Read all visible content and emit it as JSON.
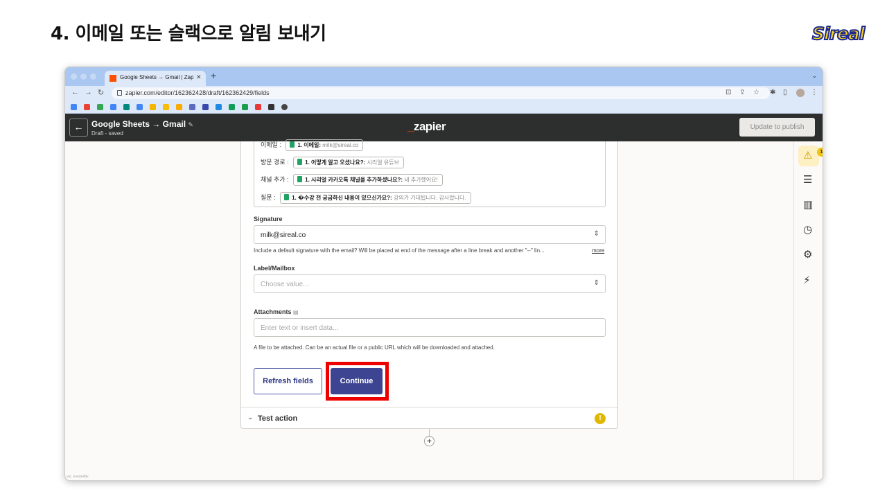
{
  "slide": {
    "title": "4. 이메일 또는 슬랙으로 알림 보내기",
    "logo_text": "Sireal"
  },
  "browser": {
    "tab_title": "Google Sheets → Gmail | Zapier",
    "url": "zapier.com/editor/162362428/draft/162362429/fields"
  },
  "header": {
    "zap_name": "Google Sheets → Gmail",
    "zap_status": "Draft - saved",
    "logo": "zapier",
    "publish_label": "Update to publish"
  },
  "rail": {
    "warning_count": "1"
  },
  "message_body": {
    "lines": [
      {
        "prefix": "이메일 :",
        "field": "1. 이메일:",
        "value": "milk@sireal.co"
      },
      {
        "prefix": "방문 경로 :",
        "field": "1. 어떻게 알고 오셨나요?:",
        "value": "시리얼 유튜브"
      },
      {
        "prefix": "채널 추가 :",
        "field": "1. 시리얼 카카오톡 채널을 추가하셨나요?:",
        "value": "네 추가했어요!"
      },
      {
        "prefix": "질문 :",
        "field": "1. �수강 전 궁금하신 내용이 있으신가요?:",
        "value": "강의가 기대됩니다. 감사합니다."
      }
    ]
  },
  "signature": {
    "label": "Signature",
    "value": "milk@sireal.co",
    "help": "Include a default signature with the email? Will be placed at end of the message after a line break and another \"--\" lin...",
    "more": "more"
  },
  "label_mailbox": {
    "label": "Label/Mailbox",
    "placeholder": "Choose value..."
  },
  "attachments": {
    "label": "Attachments",
    "placeholder": "Enter text or insert data...",
    "help": "A file to be attached. Can be an actual file or a public URL which will be downloaded and attached."
  },
  "buttons": {
    "refresh": "Refresh fields",
    "continue": "Continue"
  },
  "test_action": {
    "label": "Test action",
    "warning": "!"
  },
  "version": "ver. eeede48e",
  "colors": {
    "zapier_orange": "#ff4f00",
    "continue_bg": "#3d4592",
    "highlight": "#ee0000",
    "warning": "#e1b800"
  }
}
